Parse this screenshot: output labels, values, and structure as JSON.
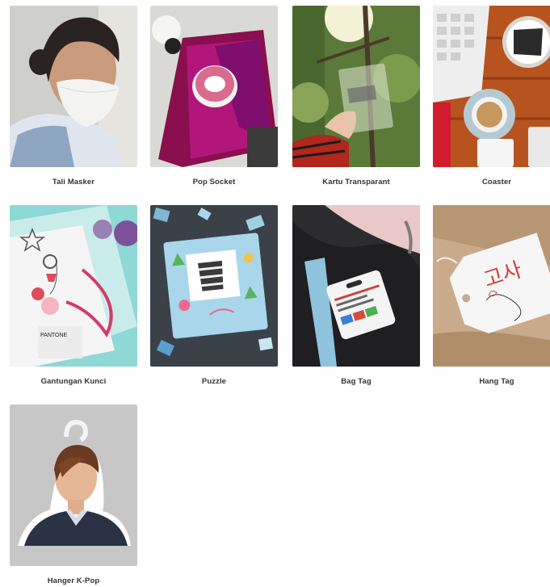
{
  "products": [
    {
      "label": "Tali Masker",
      "image": "woman-wearing-mask-photo"
    },
    {
      "label": "Pop Socket",
      "image": "phone-with-popsocket-photo"
    },
    {
      "label": "Kartu Transparant",
      "image": "transparent-card-tree-photo"
    },
    {
      "label": "Coaster",
      "image": "coaster-coffee-desk-photo"
    },
    {
      "label": "Gantungan Kunci",
      "image": "keychain-photo"
    },
    {
      "label": "Puzzle",
      "image": "puzzle-photo"
    },
    {
      "label": "Bag Tag",
      "image": "bag-tag-photo"
    },
    {
      "label": "Hang Tag",
      "image": "hang-tag-photo"
    },
    {
      "label": "Hanger K-Pop",
      "image": "kpop-hanger-photo"
    }
  ],
  "colors": {
    "label": "#333333",
    "background": "#ffffff"
  }
}
